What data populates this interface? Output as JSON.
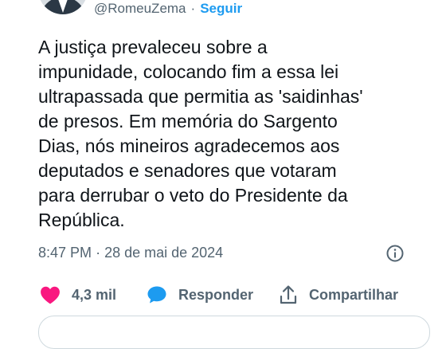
{
  "author": {
    "handle": "@RomeuZema",
    "separator": "·",
    "follow_label": "Seguir"
  },
  "tweet": {
    "text": "A justiça prevaleceu sobre a\nimpunidade, colocando fim a essa lei\nultrapassada que permitia as 'saidinhas'\nde presos. Em memória do Sargento\nDias, nós mineiros agradecemos aos\ndeputados e senadores que votaram\npara derrubar o veto do Presidente da\nRepública.",
    "time": "8:47 PM",
    "meta_separator": "·",
    "date": "28 de mai de 2024"
  },
  "actions": {
    "like_count": "4,3 mil",
    "reply_label": "Responder",
    "share_label": "Compartilhar"
  },
  "colors": {
    "like": "#f91880",
    "reply": "#1d9bf0",
    "follow": "#1d9bf0",
    "secondary_text": "#536471"
  },
  "icons": [
    "avatar",
    "info-icon",
    "heart-icon",
    "reply-bubble-icon",
    "share-icon"
  ]
}
